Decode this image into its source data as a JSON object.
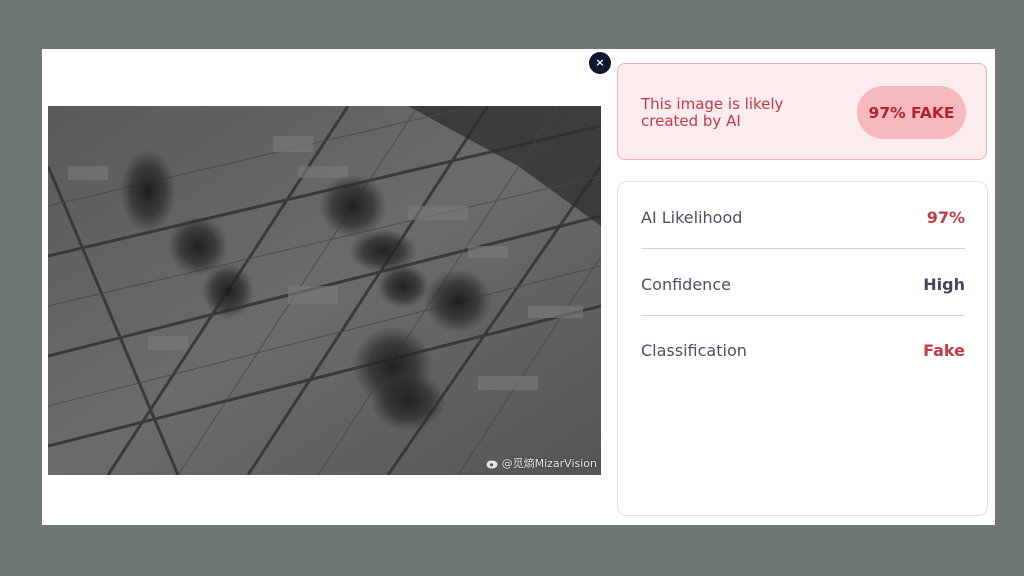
{
  "close_button": {
    "label": "×"
  },
  "image": {
    "description_icon": "weibo-icon",
    "watermark": "@觅熵MizarVision"
  },
  "verdict": {
    "message": "This image is likely created by AI",
    "badge": "97% FAKE",
    "colors": {
      "background": "#fdecee",
      "border": "#f1aeb4",
      "badge_bg": "#f7b9bf",
      "text": "#c23a45"
    }
  },
  "details": {
    "rows": [
      {
        "label": "AI Likelihood",
        "value": "97%",
        "color": "#c33c45"
      },
      {
        "label": "Confidence",
        "value": "High",
        "color": "#414a57"
      },
      {
        "label": "Classification",
        "value": "Fake",
        "color": "#c33c45"
      }
    ]
  }
}
